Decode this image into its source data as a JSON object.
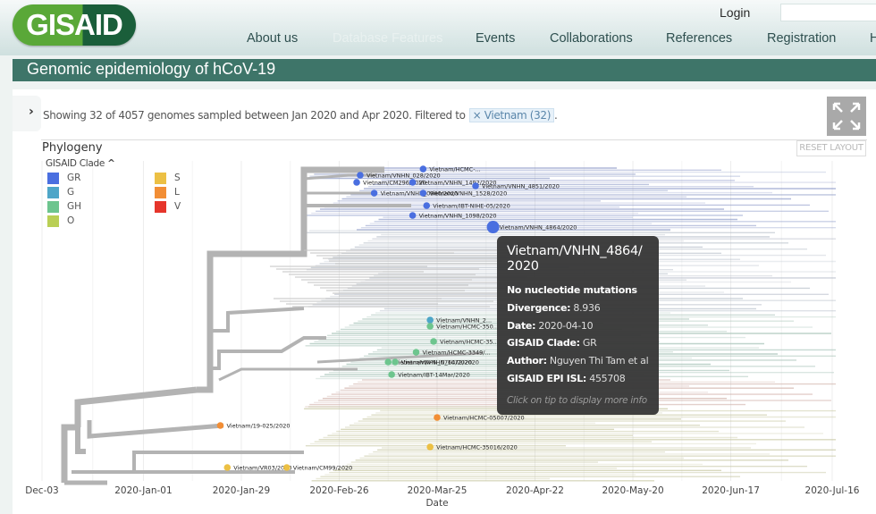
{
  "header": {
    "logo": "GISAID",
    "login_label": "Login",
    "nav": [
      {
        "label": "About us",
        "active": true
      },
      {
        "label": "Database Features",
        "active": false
      },
      {
        "label": "Events",
        "active": true
      },
      {
        "label": "Collaborations",
        "active": true
      },
      {
        "label": "References",
        "active": true
      },
      {
        "label": "Registration",
        "active": true
      },
      {
        "label": "H",
        "active": true
      }
    ]
  },
  "page_title": "Genomic epidemiology of hCoV-19",
  "info": {
    "text": "Showing 32 of 4057 genomes sampled between Jan 2020 and Apr 2020. Filtered to",
    "filter_chip": "× Vietnam (32)",
    "suffix": "."
  },
  "reset_layout_label": "RESET LAYOUT",
  "phylogeny": {
    "title": "Phylogeny",
    "legend_title": "GISAID Clade",
    "legend": [
      {
        "label": "GR",
        "color": "#4a6fe0"
      },
      {
        "label": "G",
        "color": "#4ea6c8"
      },
      {
        "label": "GH",
        "color": "#6dc58e"
      },
      {
        "label": "O",
        "color": "#b9cf55"
      },
      {
        "label": "S",
        "color": "#ecc044"
      },
      {
        "label": "L",
        "color": "#f28e35"
      },
      {
        "label": "V",
        "color": "#e6352b"
      }
    ]
  },
  "chart_data": {
    "type": "scatter",
    "title": "Phylogeny",
    "xlabel": "Date",
    "ylabel": "",
    "x_ticks": [
      "Dec-03",
      "2020-Jan-01",
      "2020-Jan-29",
      "2020-Feb-26",
      "2020-Mar-25",
      "2020-Apr-22",
      "2020-May-20",
      "2020-Jun-17",
      "2020-Jul-16"
    ],
    "xlim": [
      "2019-12-03",
      "2020-07-16"
    ],
    "legend": "top-left",
    "grid": true,
    "tips": [
      {
        "name": "Vietnam/HCMC-...",
        "date": "2020-03-21",
        "clade": "GR",
        "row": 1
      },
      {
        "name": "Vietnam/VNHN_028/2020",
        "date": "2020-03-03",
        "clade": "GR",
        "row": 2
      },
      {
        "name": "Vietnam/CM296/2020",
        "date": "2020-03-02",
        "clade": "GR",
        "row": 3
      },
      {
        "name": "Vietnam/VNHN_1492/2020",
        "date": "2020-03-18",
        "clade": "GR",
        "row": 3
      },
      {
        "name": "Vietnam/VNHN_4851/2020",
        "date": "2020-04-05",
        "clade": "GR",
        "row": 4
      },
      {
        "name": "Vietnam/VNHN_0960/2020",
        "date": "2020-03-07",
        "clade": "GR",
        "row": 5
      },
      {
        "name": "Vietnam/VNHN_1528/2020",
        "date": "2020-03-21",
        "clade": "GR",
        "row": 5
      },
      {
        "name": "Vietnam/IBT-NIHE-05/2020",
        "date": "2020-03-22",
        "clade": "GR",
        "row": 6
      },
      {
        "name": "Vietnam/VNHN_1098/2020",
        "date": "2020-03-18",
        "clade": "GR",
        "row": 7
      },
      {
        "name": "Vietnam/VNHN_4864/2020",
        "date": "2020-04-10",
        "clade": "GR",
        "row": 8
      },
      {
        "name": "Vietnam/VNHN_2...",
        "date": "2020-03-23",
        "clade": "G",
        "row": 9
      },
      {
        "name": "Vietnam/HCMC-350...",
        "date": "2020-03-23",
        "clade": "GH",
        "row": 10
      },
      {
        "name": "Vietnam/HCMC-35...",
        "date": "2020-03-24",
        "clade": "GH",
        "row": 11
      },
      {
        "name": "Vietnam/HCMC-3349/...",
        "date": "2020-03-19",
        "clade": "GH",
        "row": 12
      },
      {
        "name": "Vietnam/VNHN_0764/2020",
        "date": "2020-03-11",
        "clade": "GH",
        "row": 13
      },
      {
        "name": "Vietnam/VNHN_1072/2020",
        "date": "2020-03-13",
        "clade": "GH",
        "row": 13
      },
      {
        "name": "Vietnam/IBT-14Mar/2020",
        "date": "2020-03-12",
        "clade": "GH",
        "row": 14
      },
      {
        "name": "Vietnam/HCMC-05007/2020",
        "date": "2020-03-25",
        "clade": "L",
        "row": 15
      },
      {
        "name": "Vietnam/19-025/2020",
        "date": "2020-01-23",
        "clade": "L",
        "row": 16
      },
      {
        "name": "Vietnam/HCMC-35016/2020",
        "date": "2020-03-23",
        "clade": "S",
        "row": 17
      },
      {
        "name": "Vietnam/VR03/2020",
        "date": "2020-01-25",
        "clade": "S",
        "row": 18
      },
      {
        "name": "Vietnam/CM99/2020",
        "date": "2020-02-11",
        "clade": "S",
        "row": 18
      }
    ]
  },
  "tooltip": {
    "name": "Vietnam/VNHN_4864/ 2020",
    "mutations": "No nucleotide mutations",
    "rows": [
      {
        "key": "Divergence:",
        "value": "8.936"
      },
      {
        "key": "Date:",
        "value": "2020-04-10"
      },
      {
        "key": "GISAID Clade:",
        "value": "GR"
      },
      {
        "key": "Author:",
        "value": "Nguyen Thi Tam et al"
      },
      {
        "key": "GISAID EPI ISL:",
        "value": "455708"
      }
    ],
    "hint": "Click on tip to display more info"
  }
}
